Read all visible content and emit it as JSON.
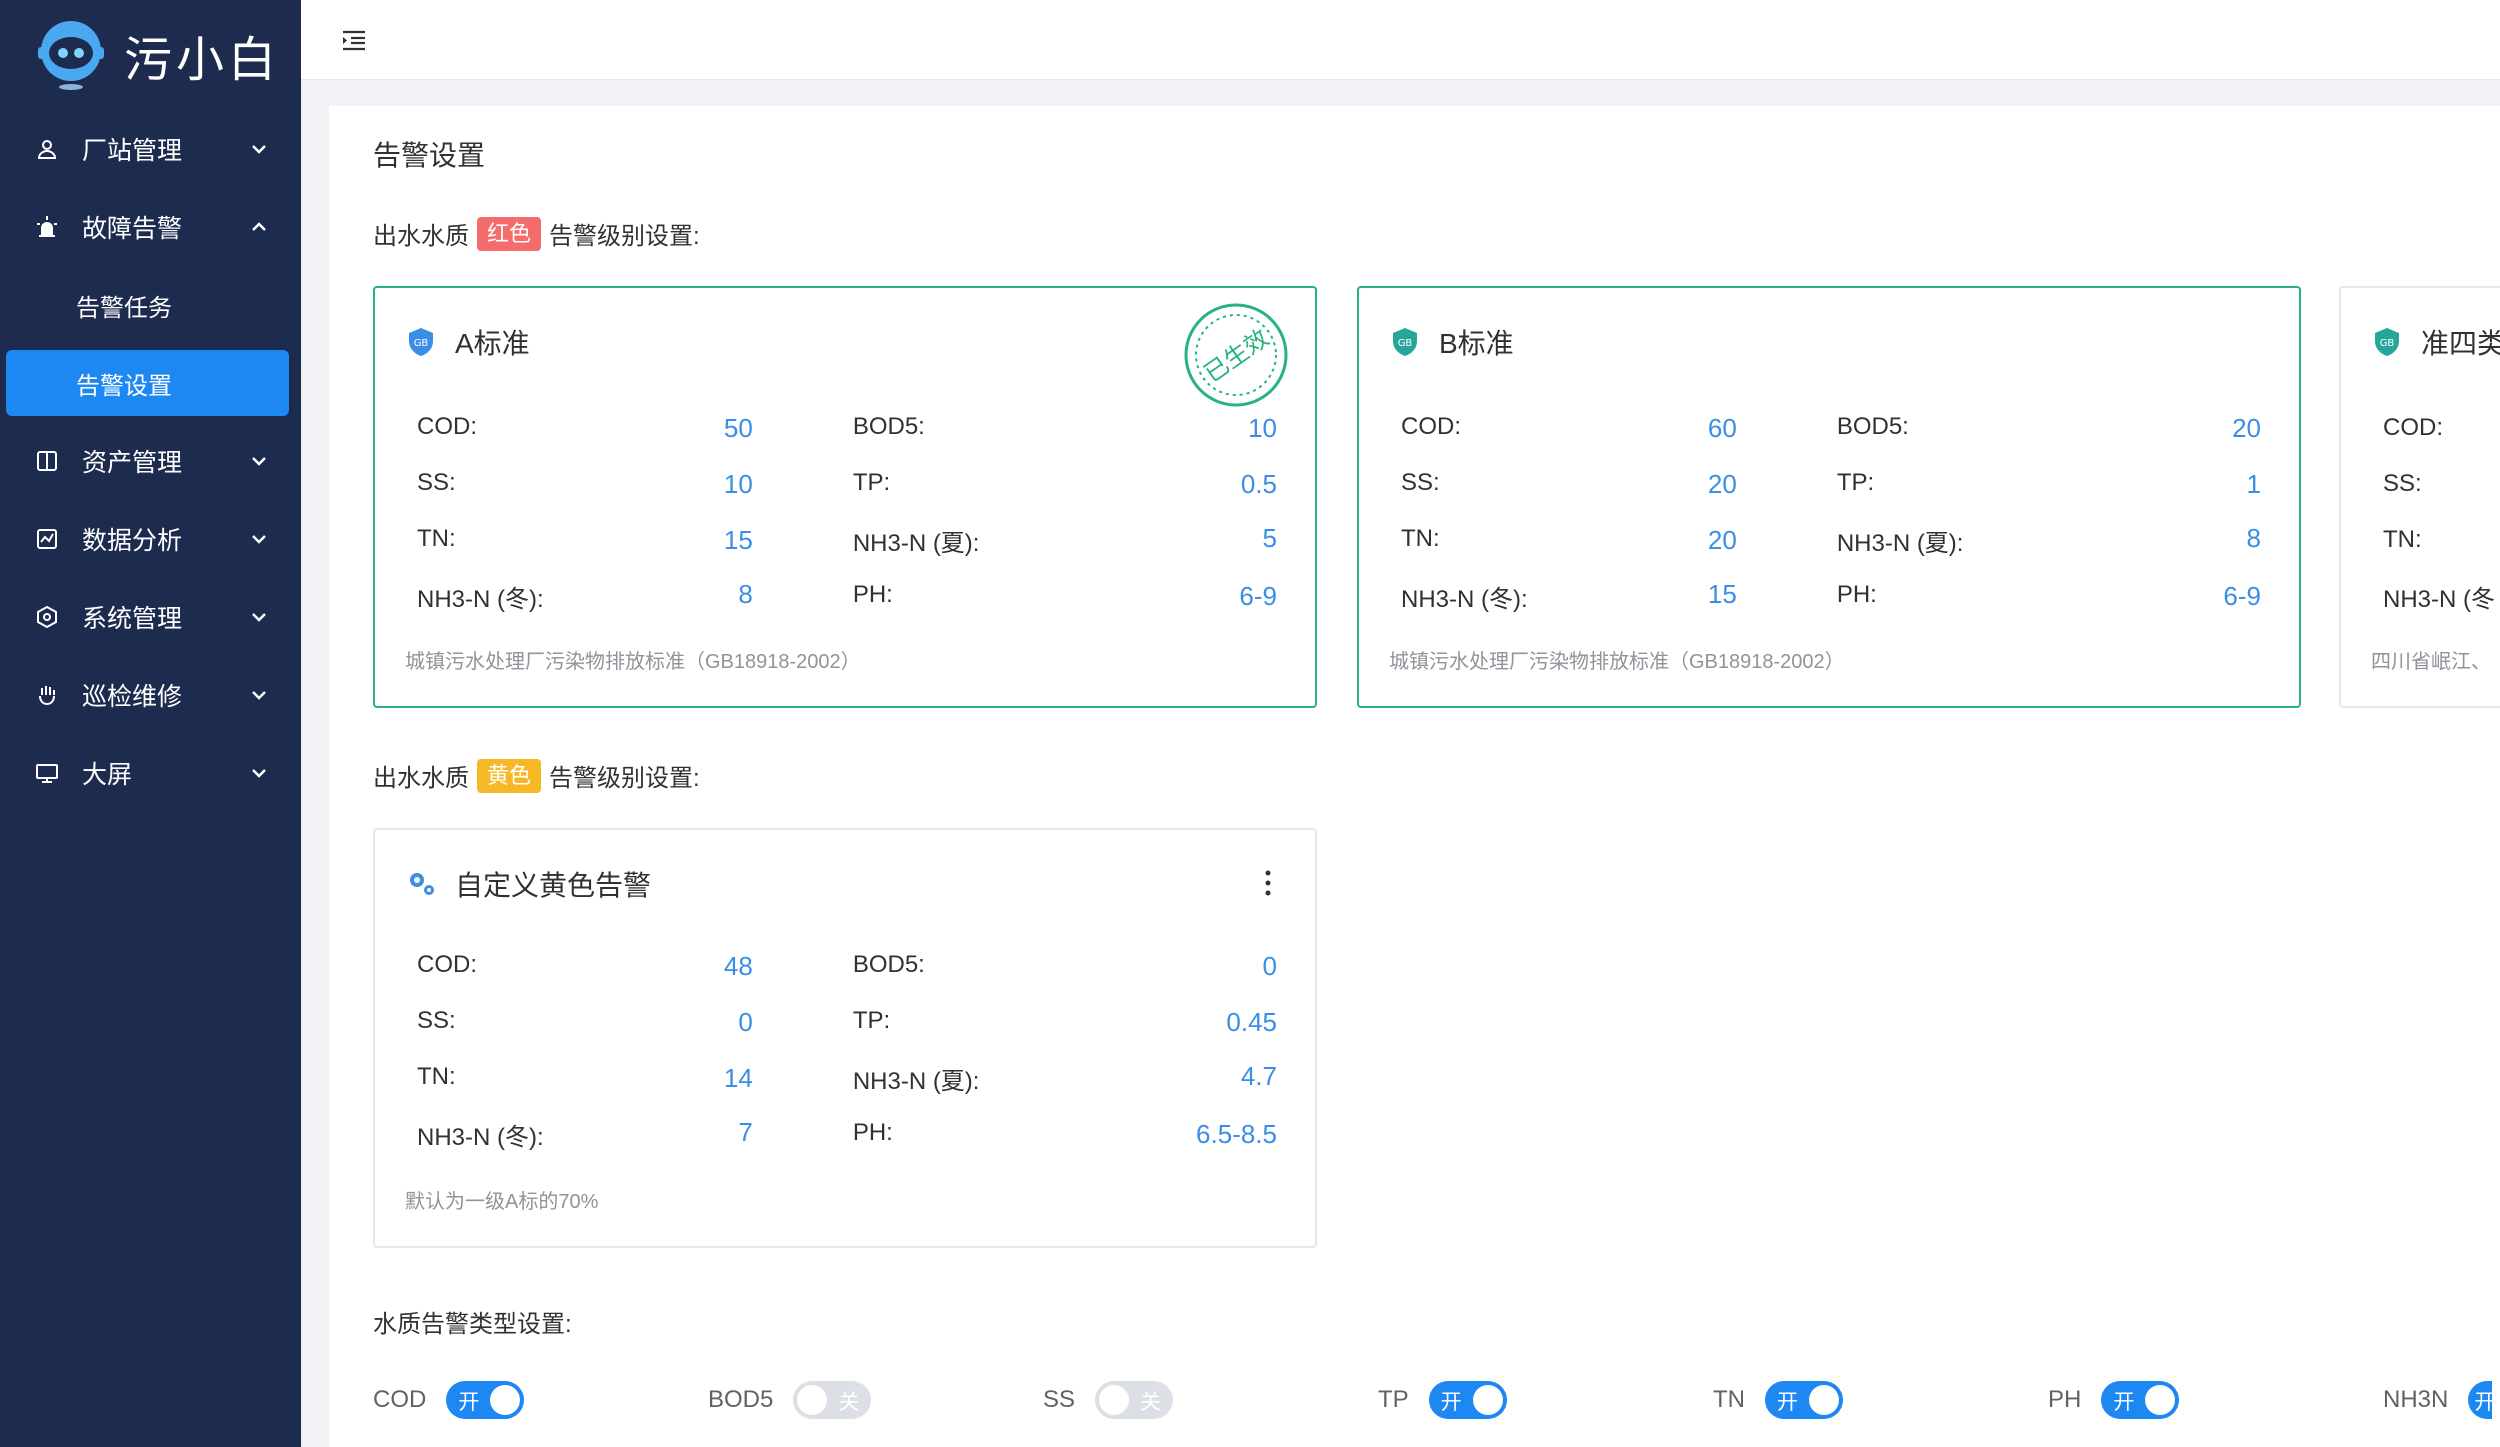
{
  "app": {
    "name": "污小白"
  },
  "sidebar": {
    "items": [
      {
        "label": "厂站管理",
        "icon": "user-icon",
        "expanded": false
      },
      {
        "label": "故障告警",
        "icon": "alarm-icon",
        "expanded": true,
        "children": [
          {
            "label": "告警任务",
            "active": false
          },
          {
            "label": "告警设置",
            "active": true
          }
        ]
      },
      {
        "label": "资产管理",
        "icon": "book-icon",
        "expanded": false
      },
      {
        "label": "数据分析",
        "icon": "chart-icon",
        "expanded": false
      },
      {
        "label": "系统管理",
        "icon": "settings-icon",
        "expanded": false
      },
      {
        "label": "巡检维修",
        "icon": "hand-icon",
        "expanded": false
      },
      {
        "label": "大屏",
        "icon": "monitor-icon",
        "expanded": false
      }
    ]
  },
  "page": {
    "title": "告警设置"
  },
  "red_section": {
    "prefix": "出水水质",
    "tag": "红色",
    "suffix": "告警级别设置:"
  },
  "yellow_section": {
    "prefix": "出水水质",
    "tag": "黄色",
    "suffix": "告警级别设置:"
  },
  "cards": [
    {
      "title": "A标准",
      "stamp": "已生效",
      "rows": [
        {
          "k1": "COD:",
          "v1": "50",
          "k2": "BOD5:",
          "v2": "10"
        },
        {
          "k1": "SS:",
          "v1": "10",
          "k2": "TP:",
          "v2": "0.5"
        },
        {
          "k1": "TN:",
          "v1": "15",
          "k2": "NH3-N (夏):",
          "v2": "5"
        },
        {
          "k1": "NH3-N (冬):",
          "v1": "8",
          "k2": "PH:",
          "v2": "6-9"
        }
      ],
      "footer": "城镇污水处理厂污染物排放标准（GB18918-2002）"
    },
    {
      "title": "B标准",
      "rows": [
        {
          "k1": "COD:",
          "v1": "60",
          "k2": "BOD5:",
          "v2": "20"
        },
        {
          "k1": "SS:",
          "v1": "20",
          "k2": "TP:",
          "v2": "1"
        },
        {
          "k1": "TN:",
          "v1": "20",
          "k2": "NH3-N (夏):",
          "v2": "8"
        },
        {
          "k1": "NH3-N (冬):",
          "v1": "15",
          "k2": "PH:",
          "v2": "6-9"
        }
      ],
      "footer": "城镇污水处理厂污染物排放标准（GB18918-2002）"
    },
    {
      "title": "准四类",
      "rows": [
        {
          "k1": "COD:"
        },
        {
          "k1": "SS:"
        },
        {
          "k1": "TN:"
        },
        {
          "k1": "NH3-N (冬"
        }
      ],
      "footer": "四川省岷江、"
    }
  ],
  "yellow_card": {
    "title": "自定义黄色告警",
    "rows": [
      {
        "k1": "COD:",
        "v1": "48",
        "k2": "BOD5:",
        "v2": "0"
      },
      {
        "k1": "SS:",
        "v1": "0",
        "k2": "TP:",
        "v2": "0.45"
      },
      {
        "k1": "TN:",
        "v1": "14",
        "k2": "NH3-N (夏):",
        "v2": "4.7"
      },
      {
        "k1": "NH3-N (冬):",
        "v1": "7",
        "k2": "PH:",
        "v2": "6.5-8.5"
      }
    ],
    "footer": "默认为一级A标的70%"
  },
  "type_section": {
    "label": "水质告警类型设置:"
  },
  "switches": [
    {
      "label": "COD",
      "on": true,
      "text": "开"
    },
    {
      "label": "BOD5",
      "on": false,
      "text": "关"
    },
    {
      "label": "SS",
      "on": false,
      "text": "关"
    },
    {
      "label": "TP",
      "on": true,
      "text": "开"
    },
    {
      "label": "TN",
      "on": true,
      "text": "开"
    },
    {
      "label": "PH",
      "on": true,
      "text": "开"
    },
    {
      "label": "NH3N",
      "on": true,
      "text": "开"
    }
  ],
  "colors": {
    "sidebar": "#1d2b4f",
    "active": "#1e88f2",
    "green": "#26b37c",
    "red": "#f56c6c",
    "yellow": "#f6b826",
    "value": "#3a8ee6"
  }
}
